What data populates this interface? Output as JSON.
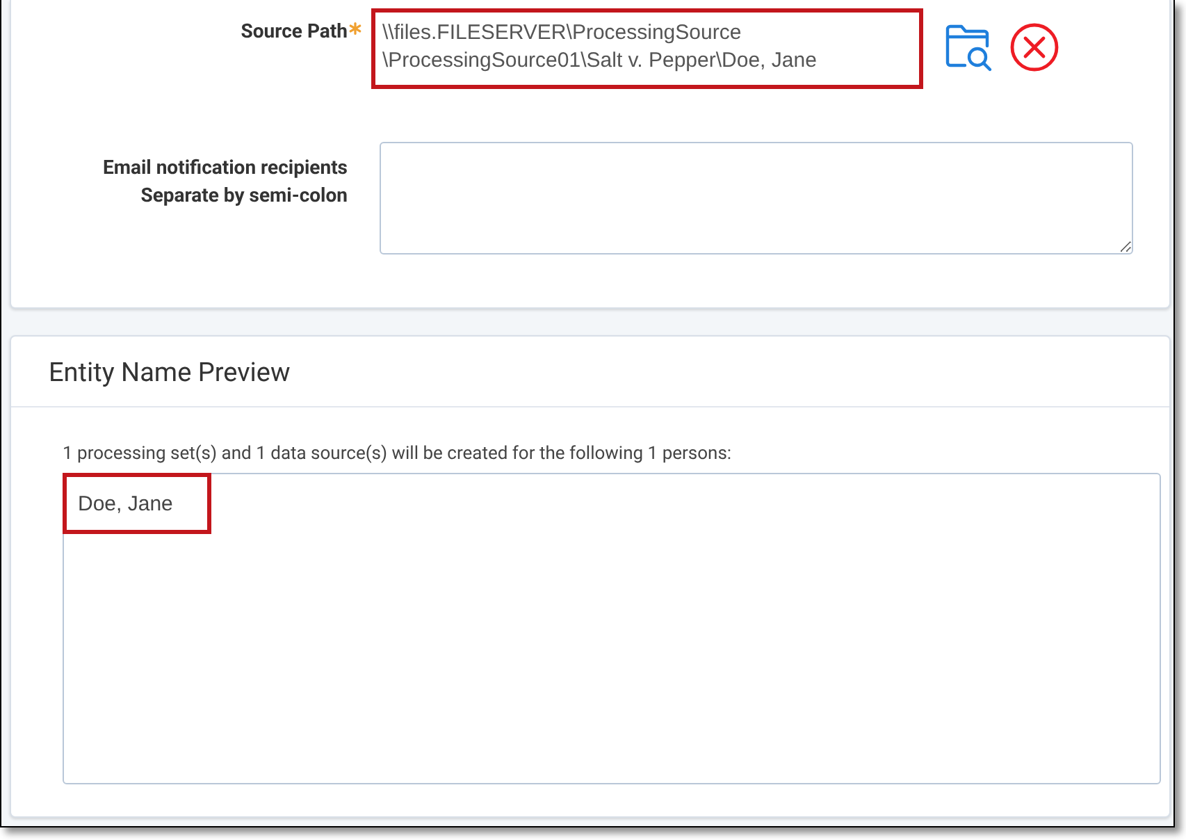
{
  "form": {
    "source_path": {
      "label": "Source Path",
      "required": true,
      "value": "\\\\files.FILESERVER\\ProcessingSource\\ProcessingSource01\\Salt v. Pepper\\Doe, Jane",
      "highlighted": true
    },
    "email_recipients": {
      "label": "Email notification recipients",
      "hint": "Separate by semi-colon"
    }
  },
  "preview": {
    "title": "Entity Name Preview",
    "message": "1 processing set(s) and 1 data source(s) will be created for the following 1 persons:",
    "persons": [
      {
        "name": "Doe, Jane",
        "highlighted": true
      }
    ]
  }
}
